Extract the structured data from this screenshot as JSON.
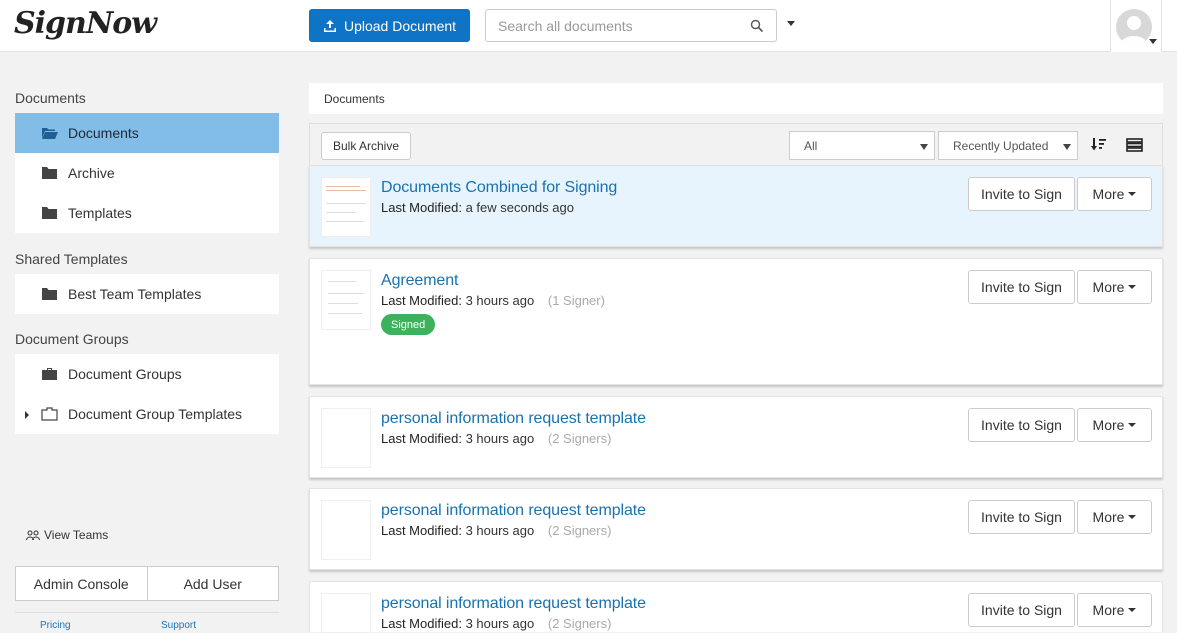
{
  "header": {
    "logo_text": "SignNow",
    "upload_label": "Upload Document",
    "search_placeholder": "Search all documents"
  },
  "sidebar": {
    "sections": [
      {
        "heading": "Documents",
        "items": [
          {
            "label": "Documents",
            "icon": "folder-open-icon",
            "active": true
          },
          {
            "label": "Archive",
            "icon": "folder-icon"
          },
          {
            "label": "Templates",
            "icon": "folder-icon"
          }
        ]
      },
      {
        "heading": "Shared Templates",
        "items": [
          {
            "label": "Best Team Templates",
            "icon": "folder-icon"
          }
        ]
      },
      {
        "heading": "Document Groups",
        "items": [
          {
            "label": "Document Groups",
            "icon": "briefcase-icon"
          },
          {
            "label": "Document Group Templates",
            "icon": "briefcase-outline-icon",
            "expandable": true
          }
        ]
      }
    ],
    "view_teams": "View Teams",
    "admin_console": "Admin Console",
    "add_user": "Add User",
    "pricing": "Pricing",
    "support": "Support"
  },
  "main": {
    "breadcrumb": "Documents",
    "bulk_archive": "Bulk Archive",
    "filter_value": "All",
    "sort_value": "Recently Updated",
    "invite_label": "Invite to Sign",
    "more_label": "More",
    "last_modified_label": "Last Modified:",
    "documents": [
      {
        "title": "Documents Combined for Signing",
        "modified": "a few seconds ago",
        "signers": "",
        "badge": ""
      },
      {
        "title": "Agreement",
        "modified": "3 hours ago",
        "signers": "(1 Signer)",
        "badge": "Signed"
      },
      {
        "title": "personal information request template",
        "modified": "3 hours ago",
        "signers": "(2 Signers)",
        "badge": ""
      },
      {
        "title": "personal information request template",
        "modified": "3 hours ago",
        "signers": "(2 Signers)",
        "badge": ""
      },
      {
        "title": "personal information request template",
        "modified": "3 hours ago",
        "signers": "(2 Signers)",
        "badge": ""
      }
    ]
  },
  "colors": {
    "accent": "#0f73c6",
    "active_item": "#82bde8",
    "link": "#1a72ad",
    "signed_badge": "#3cb25d",
    "highlight_row": "#e8f4fd"
  }
}
